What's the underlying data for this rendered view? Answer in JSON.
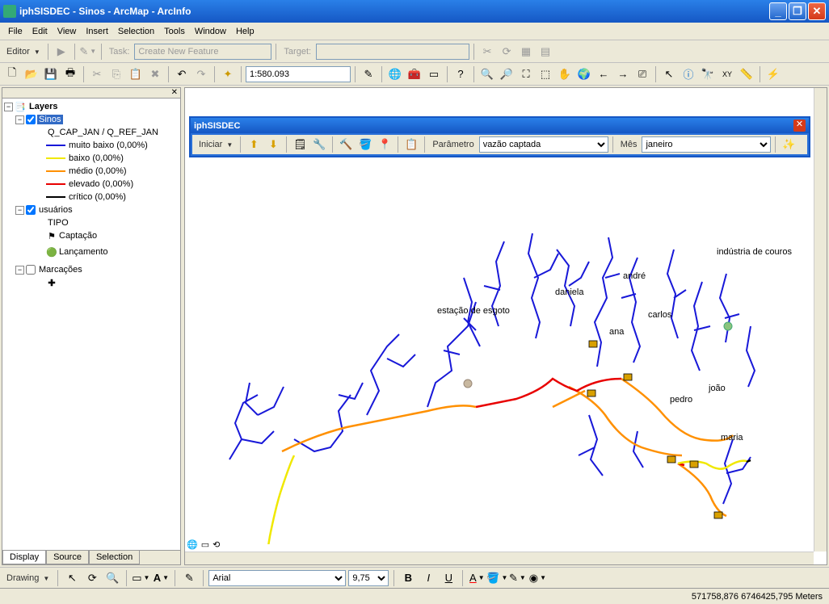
{
  "title": "iphSISDEC - Sinos - ArcMap - ArcInfo",
  "menu": [
    "File",
    "Edit",
    "View",
    "Insert",
    "Selection",
    "Tools",
    "Window",
    "Help"
  ],
  "editor_toolbar": {
    "label": "Editor",
    "task_label": "Task:",
    "task_value": "Create New Feature",
    "target_label": "Target:"
  },
  "scale": "1:580.093",
  "toc": {
    "root": "Layers",
    "sinos": "Sinos",
    "ratio": "Q_CAP_JAN / Q_REF_JAN",
    "legend": [
      {
        "color": "#1818d8",
        "label": "muito baixo (0,00%)"
      },
      {
        "color": "#f0e800",
        "label": "baixo (0,00%)"
      },
      {
        "color": "#ff9000",
        "label": "médio (0,00%)"
      },
      {
        "color": "#e80000",
        "label": "elevado (0,00%)"
      },
      {
        "color": "#000000",
        "label": "crítico (0,00%)"
      }
    ],
    "usuarios": "usuários",
    "tipo": "TIPO",
    "captacao": "Captação",
    "lancamento": "Lançamento",
    "marcacoes": "Marcações"
  },
  "toc_tabs": [
    "Display",
    "Source",
    "Selection"
  ],
  "panel": {
    "title": "iphSISDEC",
    "iniciar": "Iniciar",
    "parametro_label": "Parâmetro",
    "parametro_value": "vazão captada",
    "mes_label": "Mês",
    "mes_value": "janeiro"
  },
  "map_labels": {
    "industria": "indústria de couros",
    "andre": "andré",
    "daniela": "daniela",
    "carlos": "carlos",
    "estacao": "estação de esgoto",
    "ana": "ana",
    "joao": "joão",
    "pedro": "pedro",
    "maria": "maria"
  },
  "status": "571758,876  6746425,795 Meters",
  "drawing": {
    "label": "Drawing",
    "font": "Arial",
    "size": "9,75"
  }
}
